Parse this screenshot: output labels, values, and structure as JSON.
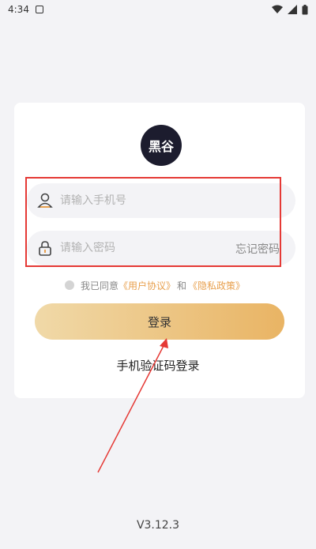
{
  "status_bar": {
    "time": "4:34",
    "icons": [
      "notification-icon",
      "wifi-icon",
      "signal-icon",
      "battery-icon"
    ]
  },
  "logo": {
    "text": "黑谷"
  },
  "phone_field": {
    "placeholder": "请输入手机号",
    "icon": "user-icon"
  },
  "password_field": {
    "placeholder": "请输入密码",
    "icon": "lock-icon",
    "forgot_label": "忘记密码"
  },
  "agreement": {
    "prefix": "我已同意",
    "user_agreement": "《用户协议》",
    "conjunction": "和",
    "privacy_policy": "《隐私政策》"
  },
  "login_button": {
    "label": "登录"
  },
  "sms_login": {
    "label": "手机验证码登录"
  },
  "version": "V3.12.3",
  "colors": {
    "accent": "#e8a04e",
    "highlight": "#e53935",
    "button_start": "#f0d9a8",
    "button_end": "#e9b464"
  }
}
